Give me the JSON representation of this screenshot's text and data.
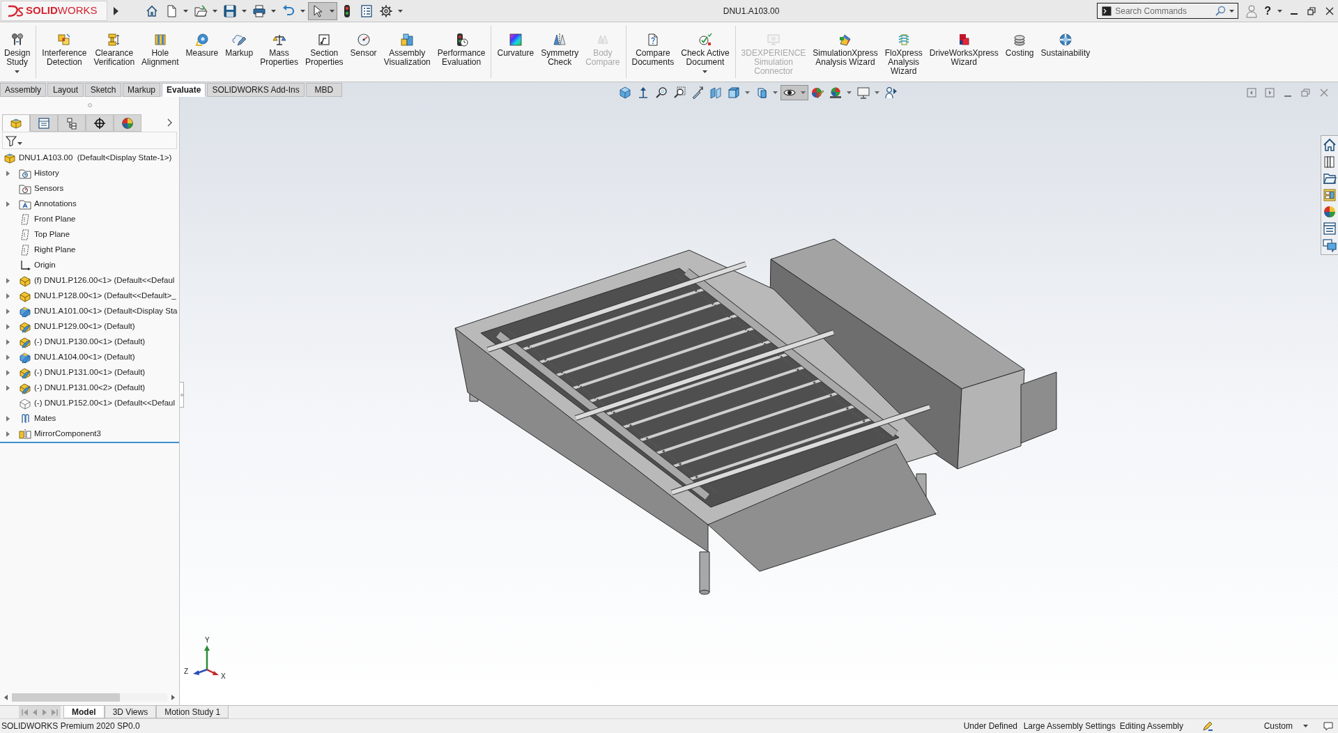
{
  "title_bar": {
    "logo": "**SOLID**WORKS",
    "quick_access": [
      {
        "selected": false
      },
      {
        "dropdown": true,
        "selected": false
      },
      {
        "dropdown": true,
        "selected": false
      },
      {
        "dropdown": true,
        "selected": false
      },
      {
        "dropdown": true,
        "selected": false
      },
      {
        "dropdown": true,
        "selected": false
      },
      {
        "dropdown": true,
        "selected": true
      },
      {
        "selected": false
      },
      {
        "selected": false
      },
      {
        "dropdown": true,
        "selected": false
      }
    ],
    "document_title": "DNU1.A103.00",
    "search": {
      "placeholder": "Search Commands"
    },
    "help": "?"
  },
  "ribbon": {
    "groups": [
      {
        "buttons": [
          {
            "label": "Design\nStudy",
            "dropdown": true,
            "disabled": false
          }
        ]
      },
      {
        "buttons": [
          {
            "label": "Interference\nDetection",
            "disabled": false
          },
          {
            "label": "Clearance\nVerification",
            "disabled": false
          },
          {
            "label": "Hole\nAlignment",
            "disabled": false
          },
          {
            "label": "Measure",
            "disabled": false
          },
          {
            "label": "Markup",
            "disabled": false
          },
          {
            "label": "Mass\nProperties",
            "disabled": false
          },
          {
            "label": "Section\nProperties",
            "disabled": false
          },
          {
            "label": "Sensor",
            "disabled": false
          },
          {
            "label": "Assembly\nVisualization",
            "disabled": false
          },
          {
            "label": "Performance\nEvaluation",
            "disabled": false
          }
        ]
      },
      {
        "buttons": [
          {
            "label": "Curvature",
            "disabled": false
          },
          {
            "label": "Symmetry\nCheck",
            "disabled": false
          },
          {
            "label": "Body\nCompare",
            "disabled": true
          }
        ]
      },
      {
        "buttons": [
          {
            "label": "Compare\nDocuments",
            "disabled": false
          },
          {
            "label": "Check Active\nDocument",
            "dropdown": true,
            "disabled": false
          }
        ]
      },
      {
        "buttons": [
          {
            "label": "3DEXPERIENCE\nSimulation\nConnector",
            "disabled": true
          },
          {
            "label": "SimulationXpress\nAnalysis Wizard",
            "disabled": false
          },
          {
            "label": "FloXpress\nAnalysis\nWizard",
            "disabled": false
          },
          {
            "label": "DriveWorksXpress\nWizard",
            "disabled": false
          },
          {
            "label": "Costing",
            "disabled": false
          },
          {
            "label": "Sustainability",
            "disabled": false
          }
        ]
      }
    ]
  },
  "command_tabs": [
    {
      "label": "Assembly",
      "selected": false
    },
    {
      "label": "Layout",
      "selected": false
    },
    {
      "label": "Sketch",
      "selected": false
    },
    {
      "label": "Markup",
      "selected": false
    },
    {
      "label": "Evaluate",
      "selected": true
    },
    {
      "label": "SOLIDWORKS Add-Ins",
      "selected": false
    },
    {
      "label": "MBD",
      "selected": false
    }
  ],
  "view_toolbar": [
    {
      "selected": false
    },
    {
      "selected": false
    },
    {
      "selected": false
    },
    {
      "selected": false
    },
    {
      "selected": false
    },
    {
      "selected": false
    },
    {
      "dropdown": true,
      "selected": false
    },
    {
      "dropdown": true,
      "selected": false
    },
    {
      "dropdown": true,
      "selected": true
    },
    {
      "selected": false
    },
    {
      "dropdown": true,
      "selected": false
    },
    {
      "dropdown": true,
      "selected": false
    },
    {
      "selected": false
    }
  ],
  "feature_tree": {
    "panel_tabs": [
      {
        "selected": true
      },
      {
        "selected": false
      },
      {
        "selected": false
      },
      {
        "selected": false
      },
      {
        "selected": false
      }
    ],
    "root": {
      "label": "DNU1.A103.00  (Default<Display State-1>)",
      "kind": "assembly",
      "children": [
        {
          "label": "History",
          "kind": "history",
          "expanded": false
        },
        {
          "label": "Sensors",
          "kind": "sensors"
        },
        {
          "label": "Annotations",
          "kind": "annotations",
          "expanded": false
        },
        {
          "label": "Front Plane",
          "kind": "plane"
        },
        {
          "label": "Top Plane",
          "kind": "plane"
        },
        {
          "label": "Right Plane",
          "kind": "plane"
        },
        {
          "label": "Origin",
          "kind": "origin"
        },
        {
          "label": "(f) DNU1.P126.00<1> (Default<<Defaul",
          "kind": "part",
          "expanded": false
        },
        {
          "label": "DNU1.P128.00<1> (Default<<Default>_",
          "kind": "part",
          "expanded": false
        },
        {
          "label": "DNU1.A101.00<1> (Default<Display Sta",
          "kind": "lightassembly",
          "expanded": false
        },
        {
          "label": "DNU1.P129.00<1> (Default)",
          "kind": "lightpart",
          "expanded": false
        },
        {
          "label": "(-) DNU1.P130.00<1> (Default)",
          "kind": "lightpart",
          "expanded": false
        },
        {
          "label": "DNU1.A104.00<1> (Default)",
          "kind": "lightassembly",
          "expanded": false
        },
        {
          "label": "(-) DNU1.P131.00<1> (Default)",
          "kind": "lightpart",
          "expanded": false
        },
        {
          "label": "(-) DNU1.P131.00<2> (Default)",
          "kind": "lightpart",
          "expanded": false
        },
        {
          "label": "(-) DNU1.P152.00<1> (Default<<Defaul",
          "kind": "suppressed"
        },
        {
          "label": "Mates",
          "kind": "mates",
          "expanded": false
        },
        {
          "label": "MirrorComponent3",
          "kind": "mirror",
          "expanded": false
        }
      ]
    }
  },
  "triad": {
    "x_label": "X",
    "y_label": "Y",
    "z_label": "Z"
  },
  "bottom_tabs": [
    {
      "label": "Model",
      "selected": true
    },
    {
      "label": "3D Views",
      "selected": false
    },
    {
      "label": "Motion Study 1",
      "selected": false
    }
  ],
  "status_bar": {
    "product": "SOLIDWORKS Premium 2020 SP0.0",
    "items": [
      "Under Defined",
      "Large Assembly Settings",
      "Editing Assembly"
    ],
    "units": "Custom"
  }
}
